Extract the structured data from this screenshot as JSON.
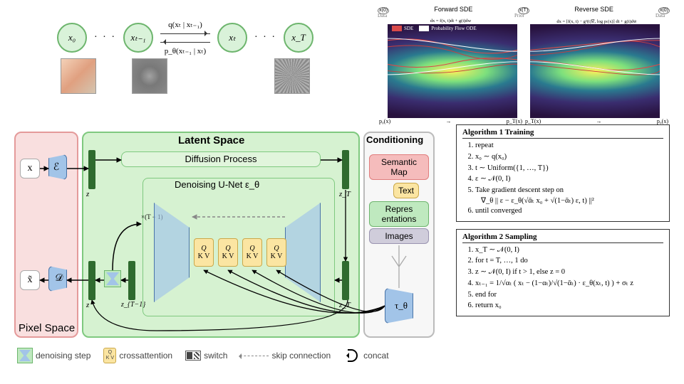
{
  "chain": {
    "nodes": [
      "x₀",
      "xₜ₋₁",
      "xₜ",
      "x_T"
    ],
    "dots": "· · ·",
    "forward_label": "q(xₜ | xₜ₋₁)",
    "reverse_label": "p_θ(xₜ₋₁ | xₜ)"
  },
  "sde": {
    "head_left": "Forward SDE",
    "head_right": "Reverse SDE",
    "data_label": "Data",
    "prior_label": "Prior",
    "eq_left": "dx = f(x, t)dt + g(t)dw",
    "eq_right": "dx = [f(x, t) − g²(t)∇ₓ log pₜ(x)] dt + g(t)dw̄",
    "legend_sde": "SDE",
    "legend_ode": "Probability Flow ODE",
    "axis_p0": "p₀(x)",
    "axis_pT": "p_T(x)",
    "node_x0": "x(0)",
    "node_xT": "x(T)"
  },
  "arch": {
    "pixel_label": "Pixel Space",
    "latent_label": "Latent Space",
    "cond_label": "Conditioning",
    "x": "x",
    "xtilde": "x̃",
    "E": "ℰ",
    "D": "𝒟",
    "z": "z",
    "zT": "z_T",
    "ztm1": "z_{T−1}",
    "diffproc": "Diffusion Process",
    "unet": "Denoising U-Net  ε_θ",
    "timesT": "×(T − 1)",
    "qkv_Q": "Q",
    "qkv_KV": "K V",
    "cond_tags": [
      "Semantic Map",
      "Text",
      "Repres entations",
      "Images"
    ],
    "tau": "τ_θ",
    "legend": {
      "dn": "denoising step",
      "ca": "crossattention",
      "sw": "switch",
      "sk": "skip connection",
      "cc": "concat"
    }
  },
  "algo1": {
    "title": "Algorithm 1 Training",
    "steps": [
      "repeat",
      "  x₀ ∼ q(x₀)",
      "  t ∼ Uniform({1, …, T})",
      "  ε ∼ 𝒩(0, I)",
      "  Take gradient descent step on",
      "    ∇_θ || ε − ε_θ(√ᾱₜ x₀ + √(1−ᾱₜ) ε, t) ||²",
      "until converged"
    ]
  },
  "algo2": {
    "title": "Algorithm 2 Sampling",
    "steps": [
      "x_T ∼ 𝒩(0, I)",
      "for t = T, …, 1 do",
      "  z ∼ 𝒩(0, I) if t > 1, else z = 0",
      "  xₜ₋₁ = 1/√αₜ ( xₜ − (1−αₜ)/√(1−ᾱₜ) · ε_θ(xₜ, t) ) + σₜ z",
      "end for",
      "return x₀"
    ]
  }
}
